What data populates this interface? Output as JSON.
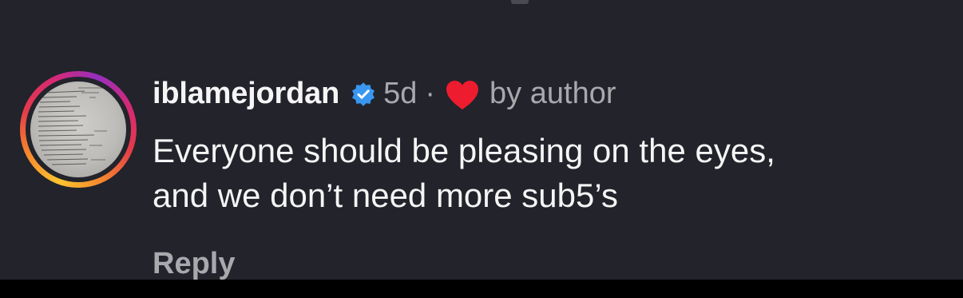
{
  "comment": {
    "username": "iblamejordan",
    "verified_icon": "verified-badge-icon",
    "time": "5d",
    "separator": "·",
    "like_icon": "heart-icon",
    "liked_by_label": "by author",
    "text": "Everyone should be pleasing on the eyes,\nand we don’t need more sub5’s",
    "reply_label": "Reply"
  },
  "colors": {
    "background": "#22232b",
    "primary_text": "#f5f5f5",
    "secondary_text": "#a8a8ad",
    "verified_blue": "#3897f0",
    "heart_red": "#ed1c2e"
  }
}
